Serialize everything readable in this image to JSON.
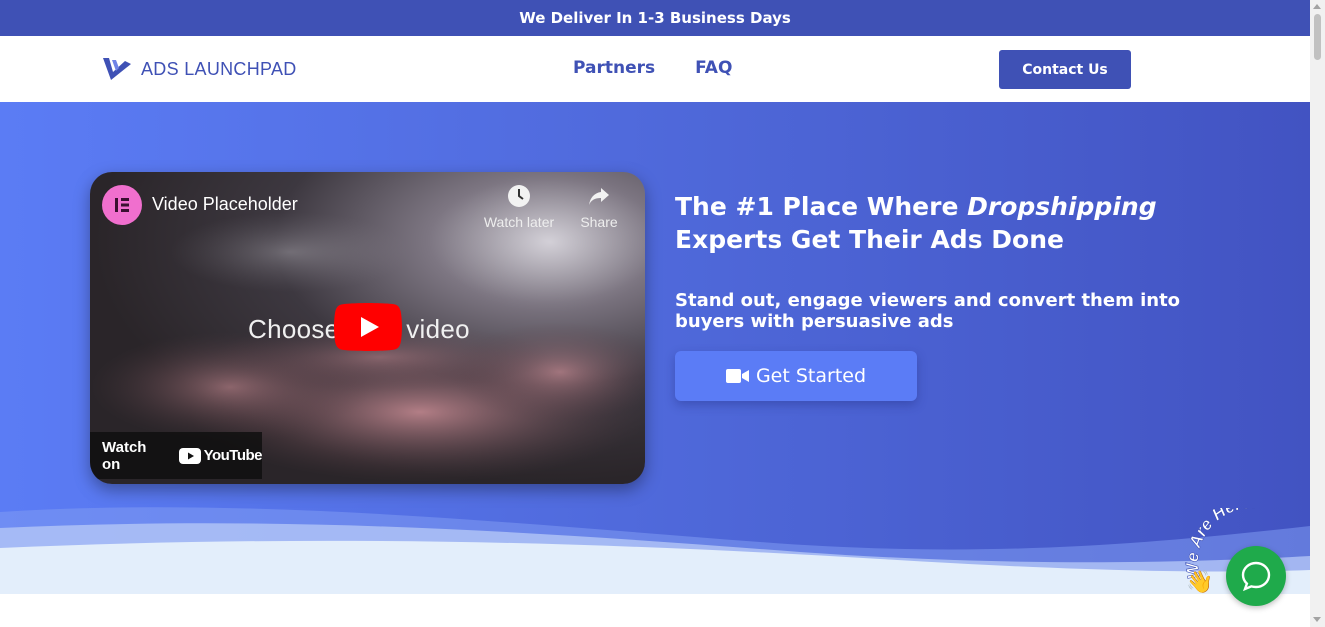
{
  "banner": {
    "text": "We Deliver In 1-3 Business Days"
  },
  "header": {
    "logo_text": "ADS LAUNCHPAD",
    "nav": [
      "Partners",
      "FAQ"
    ],
    "contact_label": "Contact Us"
  },
  "video": {
    "title": "Video Placeholder",
    "watch_later": "Watch later",
    "share": "Share",
    "center_text": "Choose your video",
    "watch_on": "Watch on",
    "youtube": "YouTube"
  },
  "hero": {
    "headline_part1": "The #1 Place Where",
    "headline_accent": "Dropshipping",
    "headline_part2": "Experts Get Their Ads Done",
    "subline": "Stand out, engage viewers and convert them into buyers with persuasive ads",
    "cta_label": "Get Started"
  },
  "chat": {
    "badge_text": "We Are Here!"
  },
  "colors": {
    "brand": "#3f51b5",
    "hero_start": "#5b7cf5",
    "hero_end": "#4253c2",
    "chat": "#1faa4b",
    "youtube_red": "#ff0000"
  }
}
